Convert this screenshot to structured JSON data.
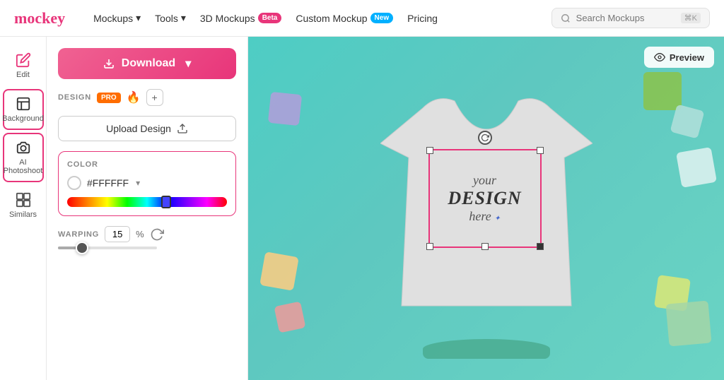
{
  "header": {
    "logo": "mockey",
    "nav": [
      {
        "label": "Mockups",
        "has_chevron": true
      },
      {
        "label": "Tools",
        "has_chevron": true
      },
      {
        "label": "3D Mockups",
        "badge": "Beta",
        "badge_type": "beta"
      },
      {
        "label": "Custom Mockup",
        "badge": "New",
        "badge_type": "new"
      },
      {
        "label": "Pricing"
      }
    ],
    "search_placeholder": "Search Mockups",
    "search_shortcut": "⌘K"
  },
  "sidebar": {
    "items": [
      {
        "id": "edit",
        "label": "Edit",
        "active": false
      },
      {
        "id": "background",
        "label": "Background",
        "active": true
      },
      {
        "id": "ai-photoshoot",
        "label": "AI Photoshoot",
        "active": true
      },
      {
        "id": "similars",
        "label": "Similars",
        "active": false
      }
    ]
  },
  "controls": {
    "download_label": "Download",
    "design_label": "DESIGN",
    "pro_label": "PRO",
    "upload_label": "Upload Design",
    "color_section_label": "COLOR",
    "color_hex": "#FFFFFF",
    "warping_label": "WARPING",
    "warping_value": "15",
    "warping_unit": "%"
  },
  "canvas": {
    "preview_label": "Preview",
    "design_line1": "your",
    "design_line2": "DESIGN",
    "design_line3": "here"
  }
}
